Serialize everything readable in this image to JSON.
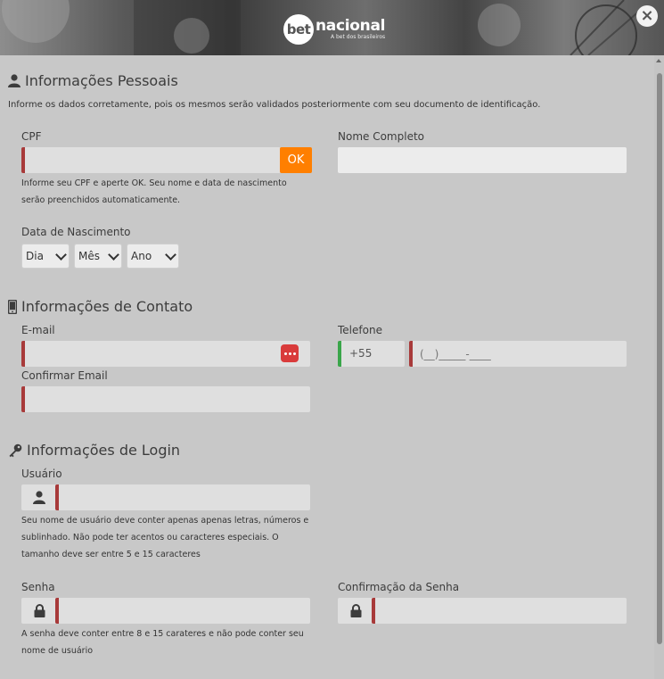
{
  "brand": {
    "logo_bet": "bet",
    "logo_name": "nacional",
    "logo_tagline": "A bet dos brasileiros"
  },
  "window": {
    "close_symbol": "×"
  },
  "personal": {
    "title": "Informações Pessoais",
    "intro": "Informe os dados corretamente, pois os mesmos serão validados posteriormente com seu documento de identificação.",
    "cpf_label": "CPF",
    "cpf_value": "",
    "ok_label": "OK",
    "cpf_help": "Informe seu CPF e aperte OK. Seu nome e data de nascimento serão preenchidos automaticamente.",
    "name_label": "Nome Completo",
    "name_value": "",
    "birth_label": "Data de Nascimento",
    "day": "Dia",
    "month": "Mês",
    "year": "Ano"
  },
  "contact": {
    "title": "Informações de Contato",
    "email_label": "E-mail",
    "email_value": "",
    "confirm_email_label": "Confirmar Email",
    "confirm_email_value": "",
    "phone_label": "Telefone",
    "phone_prefix": "+55",
    "phone_placeholder": "(__)_____-____"
  },
  "login": {
    "title": "Informações de Login",
    "user_label": "Usuário",
    "user_value": "",
    "user_help": "Seu nome de usuário deve conter apenas apenas letras, números e sublinhado. Não pode ter acentos ou caracteres especiais. O tamanho deve ser entre 5 e 15 caracteres",
    "password_label": "Senha",
    "password_value": "",
    "password_help": "A senha deve conter entre 8 e 15 carateres e não pode conter seu nome de usuário",
    "confirm_password_label": "Confirmação da Senha",
    "confirm_password_value": ""
  },
  "icons": {
    "personal": "user-icon",
    "contact": "mobile-phone-icon",
    "login": "key-icon",
    "user_field": "user-icon",
    "lock_field": "lock-icon",
    "password_manager": "password-manager-icon"
  },
  "colors": {
    "accent": "#ff7f00",
    "required": "#a83a3a",
    "valid": "#3aa64a",
    "field_bg": "#dfdfdf"
  }
}
